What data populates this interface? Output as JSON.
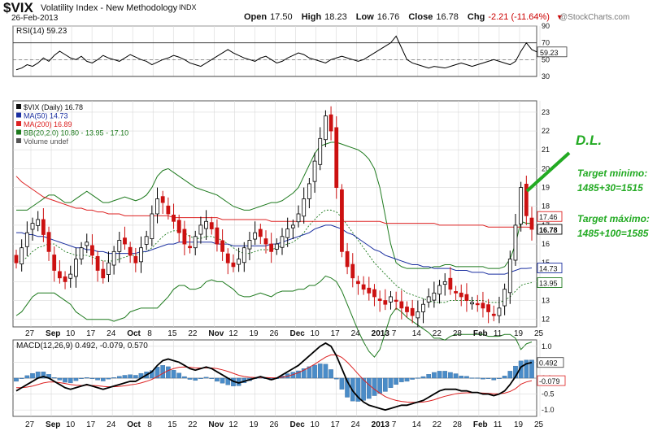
{
  "header": {
    "symbol": "$VIX",
    "name": "Volatility Index - New Methodology",
    "exchange": "INDX",
    "date": "26-Feb-2013",
    "brand": "@StockCharts.com",
    "open_label": "Open",
    "open": "17.50",
    "high_label": "High",
    "high": "18.23",
    "low_label": "Low",
    "low": "16.76",
    "close_label": "Close",
    "close": "16.78",
    "chg_label": "Chg",
    "chg": "-2.21 (-11.64%)"
  },
  "colors": {
    "price_up": "#000000",
    "price_down": "#cc1111",
    "ma50": "#1a2fa0",
    "ma200": "#dd2222",
    "bollinger": "#1e7a1e",
    "macd_line": "#000000",
    "signal_line": "#dd2222",
    "histogram": "#4a8cc8",
    "annotation": "#22aa22",
    "grid": "#d9d9d9"
  },
  "chart_data": [
    {
      "type": "line",
      "panel": "rsi",
      "title": "RSI(14) 59.23",
      "ylim": [
        30,
        90
      ],
      "yticks": [
        30,
        50,
        70,
        90
      ],
      "reference_lines": [
        30,
        70
      ],
      "last_value_label": "59.23",
      "series": [
        {
          "name": "RSI(14)",
          "values": [
            38,
            40,
            44,
            42,
            46,
            52,
            48,
            55,
            60,
            56,
            52,
            50,
            54,
            48,
            46,
            50,
            55,
            52,
            50,
            48,
            52,
            56,
            53,
            50,
            48,
            44,
            47,
            50,
            52,
            55,
            53,
            50,
            46,
            44,
            42,
            46,
            50,
            54,
            58,
            62,
            58,
            55,
            52,
            50,
            48,
            52,
            54,
            50,
            46,
            48,
            52,
            55,
            58,
            56,
            52,
            50,
            48,
            46,
            50,
            52,
            54,
            52,
            50,
            48,
            50,
            54,
            58,
            62,
            66,
            70,
            78,
            64,
            50,
            46,
            44,
            42,
            40,
            42,
            41,
            40,
            42,
            44,
            46,
            44,
            42,
            44,
            46,
            48,
            50,
            48,
            46,
            44,
            48,
            60,
            70,
            62,
            59
          ]
        }
      ]
    },
    {
      "type": "candlestick",
      "panel": "price",
      "title": "$VIX (Daily) 16.78",
      "ylim": [
        11.6,
        23.6
      ],
      "yticks": [
        12,
        13,
        14,
        15,
        16,
        17,
        18,
        19,
        20,
        21,
        22,
        23
      ],
      "legend": [
        "$VIX (Daily) 16.78",
        "MA(50) 14.73",
        "MA(200) 16.89",
        "BB(20,2.0) 10.80 - 13.95 - 17.10",
        "Volume undef"
      ],
      "last_value_labels": [
        "17.46",
        "16.78",
        "14.73",
        "13.95"
      ],
      "x_tick_labels": [
        "27",
        "Sep",
        "10",
        "17",
        "24",
        "Oct",
        "8",
        "15",
        "22",
        "Nov",
        "12",
        "19",
        "26",
        "Dec",
        "10",
        "17",
        "24",
        "2013",
        "7",
        "14",
        "22",
        "28",
        "Feb",
        "11",
        "19",
        "25"
      ],
      "close": [
        15.0,
        15.8,
        16.6,
        17.1,
        17.3,
        16.5,
        15.6,
        14.6,
        14.2,
        14.0,
        14.4,
        15.2,
        15.8,
        16.1,
        15.4,
        14.6,
        14.2,
        15.0,
        15.6,
        16.2,
        16.0,
        15.4,
        15.0,
        15.8,
        16.4,
        17.6,
        18.4,
        18.2,
        17.6,
        17.2,
        16.6,
        16.0,
        15.8,
        16.4,
        17.0,
        17.2,
        16.8,
        16.0,
        15.6,
        15.0,
        14.8,
        15.2,
        15.8,
        16.2,
        16.6,
        16.4,
        16.0,
        15.6,
        16.0,
        16.4,
        16.8,
        17.0,
        17.6,
        18.4,
        19.2,
        20.4,
        21.6,
        22.8,
        22.0,
        19.0,
        15.6,
        14.8,
        14.2,
        13.9,
        13.6,
        13.4,
        13.2,
        13.0,
        12.8,
        13.2,
        13.0,
        12.6,
        12.4,
        12.2,
        12.4,
        12.8,
        13.2,
        13.4,
        13.8,
        14.0,
        13.6,
        13.4,
        13.2,
        13.0,
        12.9,
        12.8,
        12.6,
        12.4,
        12.2,
        12.6,
        13.6,
        15.2,
        17.0,
        19.0,
        17.5,
        16.78
      ],
      "series": [
        {
          "name": "MA(50) 14.73",
          "values": [
            16.6,
            16.6,
            16.5,
            16.5,
            16.4,
            16.4,
            16.3,
            16.2,
            16.1,
            16.0,
            15.9,
            15.8,
            15.8,
            15.7,
            15.7,
            15.6,
            15.6,
            15.5,
            15.5,
            15.5,
            15.5,
            15.5,
            15.5,
            15.6,
            15.6,
            15.7,
            15.8,
            15.9,
            16.0,
            16.0,
            16.1,
            16.1,
            16.1,
            16.1,
            16.1,
            16.1,
            16.1,
            16.0,
            16.0,
            16.0,
            15.9,
            15.9,
            15.9,
            15.9,
            15.9,
            15.9,
            15.9,
            16.0,
            16.0,
            16.1,
            16.2,
            16.3,
            16.4,
            16.5,
            16.6,
            16.8,
            16.9,
            17.0,
            17.0,
            16.9,
            16.8,
            16.6,
            16.5,
            16.3,
            16.1,
            15.9,
            15.7,
            15.6,
            15.4,
            15.3,
            15.2,
            15.1,
            15.0,
            14.9,
            14.9,
            14.8,
            14.8,
            14.7,
            14.7,
            14.7,
            14.7,
            14.6,
            14.6,
            14.6,
            14.5,
            14.5,
            14.5,
            14.4,
            14.4,
            14.4,
            14.4,
            14.5,
            14.6,
            14.7,
            14.7,
            14.73
          ]
        },
        {
          "name": "MA(200) 16.89",
          "values": [
            19.6,
            19.3,
            19.1,
            18.9,
            18.7,
            18.5,
            18.4,
            18.3,
            18.2,
            18.1,
            18.0,
            17.9,
            17.9,
            17.8,
            17.8,
            17.7,
            17.7,
            17.6,
            17.6,
            17.6,
            17.5,
            17.5,
            17.5,
            17.5,
            17.5,
            17.5,
            17.5,
            17.5,
            17.5,
            17.4,
            17.4,
            17.4,
            17.4,
            17.4,
            17.4,
            17.4,
            17.4,
            17.4,
            17.3,
            17.3,
            17.3,
            17.3,
            17.3,
            17.3,
            17.3,
            17.3,
            17.3,
            17.2,
            17.2,
            17.2,
            17.2,
            17.2,
            17.2,
            17.2,
            17.2,
            17.2,
            17.2,
            17.2,
            17.2,
            17.2,
            17.2,
            17.2,
            17.2,
            17.2,
            17.2,
            17.2,
            17.2,
            17.2,
            17.1,
            17.1,
            17.1,
            17.1,
            17.1,
            17.1,
            17.1,
            17.1,
            17.1,
            17.1,
            17.0,
            17.0,
            17.0,
            17.0,
            17.0,
            17.0,
            17.0,
            17.0,
            17.0,
            16.9,
            16.9,
            16.9,
            16.9,
            16.9,
            16.9,
            16.9,
            16.9,
            16.89
          ]
        },
        {
          "name": "BB upper",
          "values": [
            17.8,
            17.8,
            17.8,
            18.0,
            18.2,
            18.4,
            18.6,
            18.6,
            18.4,
            18.2,
            18.2,
            18.4,
            18.6,
            18.8,
            18.6,
            18.4,
            18.2,
            18.2,
            18.3,
            18.4,
            18.5,
            18.4,
            18.3,
            18.4,
            18.6,
            19.0,
            19.6,
            19.9,
            20.0,
            19.8,
            19.6,
            19.4,
            19.2,
            19.0,
            18.9,
            18.8,
            18.7,
            18.6,
            18.4,
            18.2,
            18.0,
            17.9,
            17.8,
            17.8,
            17.9,
            18.0,
            18.1,
            18.2,
            18.2,
            18.3,
            18.5,
            18.7,
            19.0,
            19.6,
            20.2,
            20.8,
            21.2,
            21.3,
            21.4,
            21.4,
            21.3,
            21.2,
            21.1,
            21.0,
            20.8,
            20.5,
            20.0,
            19.0,
            17.5,
            16.0,
            15.0,
            14.8,
            14.7,
            14.7,
            14.7,
            14.7,
            14.7,
            14.8,
            14.8,
            14.9,
            14.9,
            14.8,
            14.8,
            14.8,
            14.8,
            14.8,
            14.8,
            14.7,
            14.7,
            14.7,
            14.8,
            15.2,
            16.0,
            17.2,
            17.1,
            17.1
          ]
        },
        {
          "name": "BB middle",
          "values": [
            15.0,
            15.1,
            15.3,
            15.6,
            15.8,
            15.9,
            16.0,
            16.0,
            15.8,
            15.6,
            15.5,
            15.4,
            15.4,
            15.4,
            15.3,
            15.2,
            15.1,
            15.1,
            15.1,
            15.2,
            15.3,
            15.4,
            15.4,
            15.5,
            15.6,
            15.8,
            16.1,
            16.4,
            16.6,
            16.7,
            16.7,
            16.6,
            16.4,
            16.3,
            16.3,
            16.4,
            16.4,
            16.3,
            16.2,
            16.0,
            15.8,
            15.6,
            15.5,
            15.5,
            15.6,
            15.7,
            15.7,
            15.7,
            15.8,
            15.9,
            16.0,
            16.1,
            16.3,
            16.6,
            17.0,
            17.3,
            17.6,
            17.8,
            17.8,
            17.7,
            17.4,
            17.0,
            16.6,
            16.2,
            15.8,
            15.4,
            15.0,
            14.7,
            14.4,
            14.1,
            13.8,
            13.6,
            13.4,
            13.3,
            13.2,
            13.1,
            13.0,
            12.9,
            12.9,
            12.9,
            13.0,
            13.0,
            13.0,
            13.0,
            13.0,
            13.0,
            13.0,
            12.9,
            12.9,
            12.9,
            13.0,
            13.2,
            13.5,
            13.8,
            13.9,
            13.95
          ]
        },
        {
          "name": "BB lower",
          "values": [
            12.2,
            12.4,
            12.8,
            13.2,
            13.4,
            13.4,
            13.4,
            13.4,
            13.2,
            13.0,
            12.8,
            12.4,
            12.2,
            12.0,
            12.0,
            12.0,
            12.0,
            12.0,
            11.9,
            12.0,
            12.1,
            12.4,
            12.5,
            12.6,
            12.6,
            12.6,
            12.6,
            12.9,
            13.2,
            13.6,
            13.8,
            13.8,
            13.6,
            13.6,
            13.7,
            14.0,
            14.1,
            14.0,
            14.0,
            13.8,
            13.6,
            13.3,
            13.2,
            13.2,
            13.3,
            13.4,
            13.3,
            13.2,
            13.4,
            13.5,
            13.5,
            13.5,
            13.6,
            13.6,
            13.8,
            13.8,
            14.0,
            14.3,
            14.2,
            14.0,
            13.5,
            12.8,
            12.1,
            11.4,
            10.8,
            10.3,
            10.0,
            10.4,
            11.3,
            12.2,
            12.6,
            12.4,
            12.1,
            11.9,
            11.7,
            11.5,
            11.3,
            11.0,
            11.0,
            10.9,
            11.1,
            11.2,
            11.2,
            11.2,
            11.2,
            11.2,
            11.2,
            11.1,
            11.1,
            11.1,
            11.2,
            11.2,
            11.0,
            10.4,
            10.7,
            10.8
          ]
        }
      ]
    },
    {
      "type": "line",
      "panel": "macd",
      "title": "MACD(12,26,9) 0.492, -0.079, 0.570",
      "ylim": [
        -1.2,
        1.2
      ],
      "yticks": [
        -1.0,
        -0.5,
        0.0,
        0.5,
        1.0
      ],
      "last_value_labels": [
        "0.492",
        "-0.079"
      ],
      "x_tick_labels": [
        "27",
        "Sep",
        "10",
        "17",
        "24",
        "Oct",
        "8",
        "15",
        "22",
        "Nov",
        "12",
        "19",
        "26",
        "Dec",
        "10",
        "17",
        "24",
        "2013",
        "7",
        "14",
        "22",
        "28",
        "Feb",
        "11",
        "19",
        "25"
      ],
      "series": [
        {
          "name": "MACD(12,26,9) 0.492",
          "values": [
            -0.4,
            -0.3,
            -0.2,
            -0.1,
            0.0,
            0.05,
            0.0,
            -0.1,
            -0.2,
            -0.3,
            -0.35,
            -0.3,
            -0.25,
            -0.2,
            -0.25,
            -0.3,
            -0.35,
            -0.3,
            -0.25,
            -0.2,
            -0.15,
            -0.1,
            -0.1,
            0.0,
            0.1,
            0.2,
            0.4,
            0.55,
            0.6,
            0.55,
            0.5,
            0.4,
            0.3,
            0.25,
            0.3,
            0.35,
            0.3,
            0.2,
            0.1,
            0.0,
            -0.1,
            -0.15,
            -0.1,
            -0.05,
            0.0,
            0.05,
            0.0,
            -0.05,
            0.0,
            0.1,
            0.2,
            0.3,
            0.4,
            0.55,
            0.7,
            0.85,
            1.0,
            1.1,
            1.0,
            0.7,
            0.3,
            -0.1,
            -0.4,
            -0.6,
            -0.75,
            -0.85,
            -0.9,
            -0.95,
            -1.0,
            -0.95,
            -0.9,
            -0.85,
            -0.85,
            -0.8,
            -0.75,
            -0.7,
            -0.6,
            -0.5,
            -0.4,
            -0.35,
            -0.35,
            -0.35,
            -0.4,
            -0.4,
            -0.45,
            -0.45,
            -0.5,
            -0.5,
            -0.55,
            -0.5,
            -0.4,
            -0.2,
            0.05,
            0.35,
            0.45,
            0.492
          ]
        },
        {
          "name": "signal -0.079",
          "values": [
            -0.3,
            -0.3,
            -0.28,
            -0.25,
            -0.2,
            -0.15,
            -0.12,
            -0.12,
            -0.14,
            -0.17,
            -0.2,
            -0.22,
            -0.23,
            -0.22,
            -0.23,
            -0.24,
            -0.26,
            -0.27,
            -0.27,
            -0.26,
            -0.24,
            -0.21,
            -0.19,
            -0.15,
            -0.1,
            -0.04,
            0.05,
            0.15,
            0.24,
            0.3,
            0.34,
            0.35,
            0.34,
            0.32,
            0.32,
            0.32,
            0.32,
            0.3,
            0.26,
            0.21,
            0.15,
            0.09,
            0.05,
            0.03,
            0.02,
            0.02,
            0.02,
            0.01,
            0.01,
            0.03,
            0.06,
            0.11,
            0.17,
            0.25,
            0.34,
            0.44,
            0.55,
            0.66,
            0.73,
            0.73,
            0.65,
            0.5,
            0.32,
            0.13,
            -0.05,
            -0.21,
            -0.35,
            -0.47,
            -0.58,
            -0.65,
            -0.7,
            -0.73,
            -0.75,
            -0.76,
            -0.76,
            -0.75,
            -0.72,
            -0.68,
            -0.62,
            -0.57,
            -0.53,
            -0.49,
            -0.47,
            -0.46,
            -0.46,
            -0.46,
            -0.47,
            -0.48,
            -0.49,
            -0.49,
            -0.47,
            -0.42,
            -0.33,
            -0.19,
            -0.12,
            -0.079
          ]
        }
      ]
    }
  ],
  "annotations": {
    "dl": "D.L.",
    "target_min_title": "Target minimo:",
    "target_min_calc": "1485+30=1515",
    "target_max_title": "Target máximo:",
    "target_max_calc": "1485+100=1585"
  }
}
